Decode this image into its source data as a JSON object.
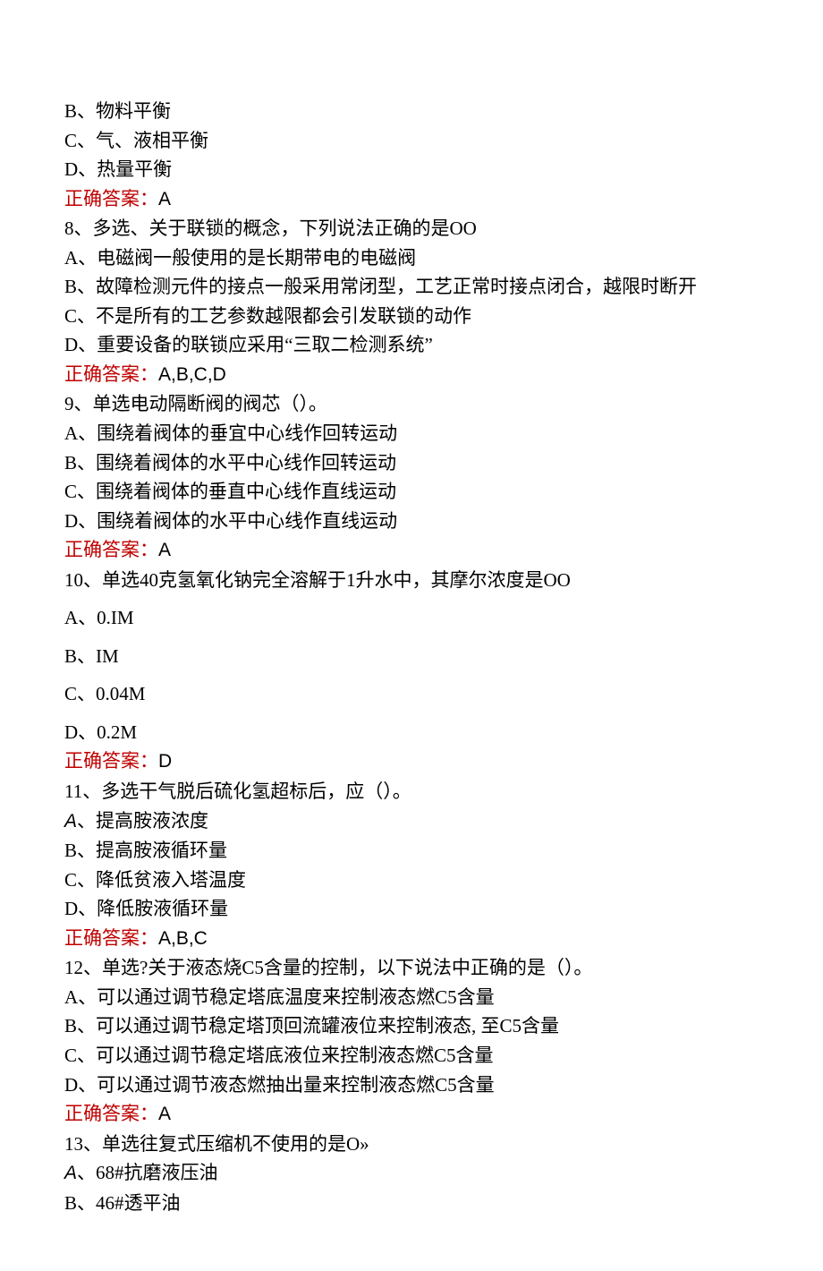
{
  "lines": [
    {
      "type": "text",
      "content": "B、物料平衡"
    },
    {
      "type": "text",
      "content": "C、气、液相平衡"
    },
    {
      "type": "text",
      "content": "D、热量平衡"
    },
    {
      "type": "answer",
      "label": "正确答案：",
      "value": "A"
    },
    {
      "type": "text",
      "content": "8、多选、关于联锁的概念，下列说法正确的是OO"
    },
    {
      "type": "text",
      "content": "A、电磁阀一般使用的是长期带电的电磁阀"
    },
    {
      "type": "text",
      "content": "B、故障检测元件的接点一般采用常闭型，工艺正常时接点闭合，越限时断开"
    },
    {
      "type": "text",
      "content": "C、不是所有的工艺参数越限都会引发联锁的动作"
    },
    {
      "type": "text",
      "content": "D、重要设备的联锁应采用“三取二检测系统”"
    },
    {
      "type": "answer",
      "label": "正确答案：",
      "value": "A,B,C,D"
    },
    {
      "type": "text",
      "content": "9、单选电动隔断阀的阀芯（）。"
    },
    {
      "type": "text",
      "content": "A、围绕着阀体的垂宜中心线作回转运动"
    },
    {
      "type": "text",
      "content": "B、围绕着阀体的水平中心线作回转运动"
    },
    {
      "type": "text",
      "content": "C、围绕着阀体的垂直中心线作直线运动"
    },
    {
      "type": "text",
      "content": "D、围绕着阀体的水平中心线作直线运动"
    },
    {
      "type": "answer",
      "label": "正确答案：",
      "value": "A"
    },
    {
      "type": "text",
      "content": "10、单选40克氢氧化钠完全溶解于1升水中，其摩尔浓度是OO"
    },
    {
      "type": "gap"
    },
    {
      "type": "text",
      "content": "A、0.IM"
    },
    {
      "type": "gap"
    },
    {
      "type": "text",
      "content": "B、IM"
    },
    {
      "type": "gap"
    },
    {
      "type": "text",
      "content": "C、0.04M"
    },
    {
      "type": "gap"
    },
    {
      "type": "text",
      "content": "D、0.2M"
    },
    {
      "type": "answer",
      "label": "正确答案：",
      "value": "D"
    },
    {
      "type": "text",
      "content": "11、多选干气脱后硫化氢超标后，应（）。"
    },
    {
      "type": "mixed",
      "prefix": "A",
      "rest": "、提高胺液浓度"
    },
    {
      "type": "text",
      "content": "B、提高胺液循环量"
    },
    {
      "type": "text",
      "content": "C、降低贫液入塔温度"
    },
    {
      "type": "text",
      "content": "D、降低胺液循环量"
    },
    {
      "type": "answer",
      "label": "正确答案：",
      "value": "A,B,C"
    },
    {
      "type": "text",
      "content": "12、单选?关于液态烧C5含量的控制，以下说法中正确的是（）。"
    },
    {
      "type": "text",
      "content": "A、可以通过调节稳定塔底温度来控制液态燃C5含量"
    },
    {
      "type": "text",
      "content": "B、可以通过调节稳定塔顶回流罐液位来控制液态, 至C5含量"
    },
    {
      "type": "text",
      "content": "C、可以通过调节稳定塔底液位来控制液态燃C5含量"
    },
    {
      "type": "text",
      "content": "D、可以通过调节液态燃抽出量来控制液态燃C5含量"
    },
    {
      "type": "answer",
      "label": "正确答案：",
      "value": "A"
    },
    {
      "type": "text",
      "content": "13、单选往复式压缩机不使用的是O»"
    },
    {
      "type": "mixed",
      "prefix": "A",
      "rest": "、68#抗磨液压油"
    },
    {
      "type": "text",
      "content": "B、46#透平油"
    }
  ]
}
